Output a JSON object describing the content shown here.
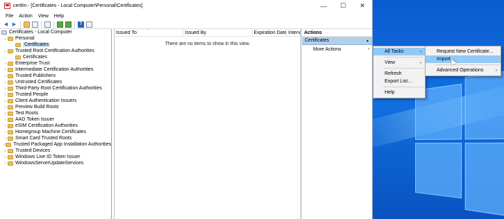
{
  "window": {
    "title": "certlm - [Certificates - Local Computer\\Personal\\Certificates]",
    "minimize_glyph": "—",
    "maximize_glyph": "☐",
    "close_glyph": "✕"
  },
  "menubar": [
    "File",
    "Action",
    "View",
    "Help"
  ],
  "toolbar": {
    "back_glyph": "◀",
    "forward_glyph": "▶",
    "help_glyph": "?"
  },
  "tree": {
    "root": "Certificates - Local Computer",
    "personal": "Personal",
    "personal_certificates": "Certificates",
    "trusted_root": "Trusted Root Certification Authorities",
    "trusted_root_certificates": "Certificates",
    "stores": [
      "Enterprise Trust",
      "Intermediate Certification Authorities",
      "Trusted Publishers",
      "Untrusted Certificates",
      "Third-Party Root Certification Authorities",
      "Trusted People",
      "Client Authentication Issuers",
      "Preview Build Roots",
      "Test Roots",
      "AAD Token Issuer",
      "eSIM Certification Authorities",
      "Homegroup Machine Certificates",
      "Smart Card Trusted Roots",
      "Trusted Packaged App Installation Authorities",
      "Trusted Devices",
      "Windows Live ID Token Issuer",
      "WindowsServerUpdateServices"
    ],
    "expanded_glyph": "⌄",
    "collapsed_glyph": "›"
  },
  "list": {
    "columns": [
      "Issued To",
      "Issued By",
      "Expiration Date",
      "Intenc"
    ],
    "empty_message": "There are no items to show in this view."
  },
  "actions": {
    "header": "Actions",
    "section": "Certificates",
    "more_actions": "More Actions"
  },
  "context_menu": {
    "all_tasks": "All Tasks",
    "view": "View",
    "refresh": "Refresh",
    "export_list": "Export List...",
    "help": "Help"
  },
  "submenu": {
    "request_new": "Request New Certificate...",
    "import": "Import...",
    "advanced": "Advanced Operations"
  },
  "glyphs": {
    "submenu_arrow": "›",
    "section_collapse": "▲",
    "sort_caret": "^"
  }
}
